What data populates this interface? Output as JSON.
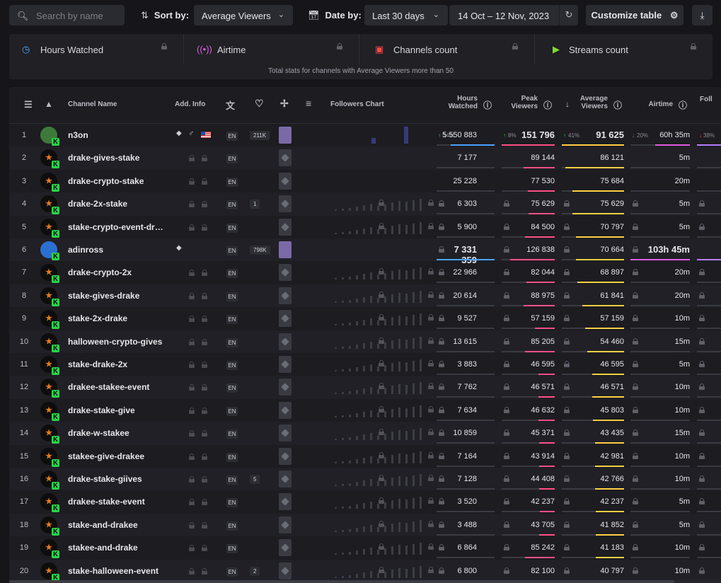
{
  "toolbar": {
    "search_placeholder": "Search by name",
    "sort_label": "Sort by:",
    "sort_value": "Average Viewers",
    "date_label": "Date by:",
    "date_range_value": "Last 30 days",
    "date_span": "14 Oct – 12 Nov, 2023",
    "customize_label": "Customize table"
  },
  "stats": {
    "items": [
      {
        "label": "Hours Watched",
        "icon": "clock-icon",
        "color": "#4aa3ff"
      },
      {
        "label": "Airtime",
        "icon": "broadcast-icon",
        "color": "#e05ce0"
      },
      {
        "label": "Channels count",
        "icon": "camera-icon",
        "color": "#ff4b4b"
      },
      {
        "label": "Streams count",
        "icon": "play-icon",
        "color": "#7fdc2a"
      }
    ],
    "caption": "Total stats for channels with Average Viewers more than 50"
  },
  "table": {
    "headers": {
      "channel": "Channel Name",
      "add_info": "Add. Info",
      "followers_chart": "Followers Chart",
      "hours_watched_1": "Hours",
      "hours_watched_2": "Watched",
      "peak_1": "Peak",
      "peak_2": "Viewers",
      "avg_1": "Average",
      "avg_2": "Viewers",
      "airtime": "Airtime",
      "followers_cut": "Foll"
    },
    "colors": {
      "hours": "#4aa3ff",
      "peak": "#ff4f86",
      "avg": "#ffcf3f",
      "airtime": "#e05ce0",
      "followers": "#b67cff",
      "up": "#2bd24a",
      "down": "#ff4b4b"
    },
    "rows": [
      {
        "rank": "1",
        "name": "n3on",
        "lang": "EN",
        "followers": "211K",
        "hours": "5 550 883",
        "hours_pct": "14%",
        "peak": "151 796",
        "peak_pct": "8%",
        "avg": "91 625",
        "avg_pct": "41%",
        "airtime": "60h 35m",
        "air_pct": "20%",
        "fol_pct": "38%",
        "hours_frac": 0.76,
        "peak_frac": 1.0,
        "avg_frac": 1.0,
        "air_frac": 0.58
      },
      {
        "rank": "2",
        "name": "drake-gives-stake",
        "lang": "EN",
        "hours": "7 177",
        "peak": "89 144",
        "avg": "86 121",
        "airtime": "5m",
        "hours_frac": 0.0,
        "peak_frac": 0.59,
        "avg_frac": 0.94,
        "air_frac": 0.0
      },
      {
        "rank": "3",
        "name": "drake-crypto-stake",
        "lang": "EN",
        "hours": "25 228",
        "peak": "77 530",
        "avg": "75 684",
        "airtime": "20m",
        "hours_frac": 0.0,
        "peak_frac": 0.51,
        "avg_frac": 0.83,
        "air_frac": 0.0
      },
      {
        "rank": "4",
        "name": "drake-2x-stake",
        "lang": "EN",
        "followers": "1",
        "hours": "6 303",
        "peak": "75 629",
        "avg": "75 629",
        "airtime": "5m",
        "hours_frac": 0.0,
        "peak_frac": 0.5,
        "avg_frac": 0.83,
        "air_frac": 0.0
      },
      {
        "rank": "5",
        "name": "stake-crypto-event-dr…",
        "lang": "EN",
        "hours": "5 900",
        "peak": "84 500",
        "avg": "70 797",
        "airtime": "5m",
        "hours_frac": 0.0,
        "peak_frac": 0.56,
        "avg_frac": 0.77,
        "air_frac": 0.0
      },
      {
        "rank": "6",
        "name": "adinross",
        "lang": "EN",
        "followers": "798K",
        "hours": "7 331 359",
        "peak": "126 838",
        "avg": "70 664",
        "airtime": "103h 45m",
        "hours_frac": 1.0,
        "peak_frac": 0.84,
        "avg_frac": 0.77,
        "air_frac": 1.0
      },
      {
        "rank": "7",
        "name": "drake-crypto-2x",
        "lang": "EN",
        "hours": "22 966",
        "peak": "82 044",
        "avg": "68 897",
        "airtime": "20m",
        "hours_frac": 0.0,
        "peak_frac": 0.54,
        "avg_frac": 0.75,
        "air_frac": 0.0
      },
      {
        "rank": "8",
        "name": "stake-gives-drake",
        "lang": "EN",
        "hours": "20 614",
        "peak": "88 975",
        "avg": "61 841",
        "airtime": "20m",
        "hours_frac": 0.0,
        "peak_frac": 0.59,
        "avg_frac": 0.67,
        "air_frac": 0.0
      },
      {
        "rank": "9",
        "name": "stake-2x-drake",
        "lang": "EN",
        "hours": "9 527",
        "peak": "57 159",
        "avg": "57 159",
        "airtime": "10m",
        "hours_frac": 0.0,
        "peak_frac": 0.38,
        "avg_frac": 0.62,
        "air_frac": 0.0
      },
      {
        "rank": "10",
        "name": "halloween-crypto-gives",
        "lang": "EN",
        "hours": "13 615",
        "peak": "85 205",
        "avg": "54 460",
        "airtime": "15m",
        "hours_frac": 0.0,
        "peak_frac": 0.56,
        "avg_frac": 0.59,
        "air_frac": 0.0
      },
      {
        "rank": "11",
        "name": "stake-drake-2x",
        "lang": "EN",
        "hours": "3 883",
        "peak": "46 595",
        "avg": "46 595",
        "airtime": "5m",
        "hours_frac": 0.0,
        "peak_frac": 0.31,
        "avg_frac": 0.51,
        "air_frac": 0.0
      },
      {
        "rank": "12",
        "name": "drakee-stakee-event",
        "lang": "EN",
        "hours": "7 762",
        "peak": "46 571",
        "avg": "46 571",
        "airtime": "10m",
        "hours_frac": 0.0,
        "peak_frac": 0.31,
        "avg_frac": 0.51,
        "air_frac": 0.0
      },
      {
        "rank": "13",
        "name": "drake-stake-give",
        "lang": "EN",
        "hours": "7 634",
        "peak": "46 632",
        "avg": "45 803",
        "airtime": "10m",
        "hours_frac": 0.0,
        "peak_frac": 0.31,
        "avg_frac": 0.5,
        "air_frac": 0.0
      },
      {
        "rank": "14",
        "name": "drake-w-stakee",
        "lang": "EN",
        "hours": "10 859",
        "peak": "45 371",
        "avg": "43 435",
        "airtime": "15m",
        "hours_frac": 0.0,
        "peak_frac": 0.3,
        "avg_frac": 0.47,
        "air_frac": 0.0
      },
      {
        "rank": "15",
        "name": "stakee-give-drakee",
        "lang": "EN",
        "hours": "7 164",
        "peak": "43 914",
        "avg": "42 981",
        "airtime": "10m",
        "hours_frac": 0.0,
        "peak_frac": 0.29,
        "avg_frac": 0.47,
        "air_frac": 0.0
      },
      {
        "rank": "16",
        "name": "drake-stake-giives",
        "lang": "EN",
        "followers": "5",
        "hours": "7 128",
        "peak": "44 408",
        "avg": "42 766",
        "airtime": "10m",
        "hours_frac": 0.0,
        "peak_frac": 0.29,
        "avg_frac": 0.47,
        "air_frac": 0.0
      },
      {
        "rank": "17",
        "name": "drakee-stake-event",
        "lang": "EN",
        "hours": "3 520",
        "peak": "42 237",
        "avg": "42 237",
        "airtime": "5m",
        "hours_frac": 0.0,
        "peak_frac": 0.28,
        "avg_frac": 0.46,
        "air_frac": 0.0
      },
      {
        "rank": "18",
        "name": "stake-and-drakee",
        "lang": "EN",
        "hours": "3 488",
        "peak": "43 705",
        "avg": "41 852",
        "airtime": "5m",
        "hours_frac": 0.0,
        "peak_frac": 0.29,
        "avg_frac": 0.46,
        "air_frac": 0.0
      },
      {
        "rank": "19",
        "name": "stakee-and-drake",
        "lang": "EN",
        "hours": "6 864",
        "peak": "85 242",
        "avg": "41 183",
        "airtime": "10m",
        "hours_frac": 0.0,
        "peak_frac": 0.56,
        "avg_frac": 0.45,
        "air_frac": 0.0
      },
      {
        "rank": "20",
        "name": "stake-halloween-event",
        "lang": "EN",
        "followers": "2",
        "hours": "6 800",
        "peak": "82 100",
        "avg": "40 797",
        "airtime": "10m",
        "hours_frac": 0.0,
        "peak_frac": 0.54,
        "avg_frac": 0.45,
        "air_frac": 0.0
      }
    ]
  }
}
